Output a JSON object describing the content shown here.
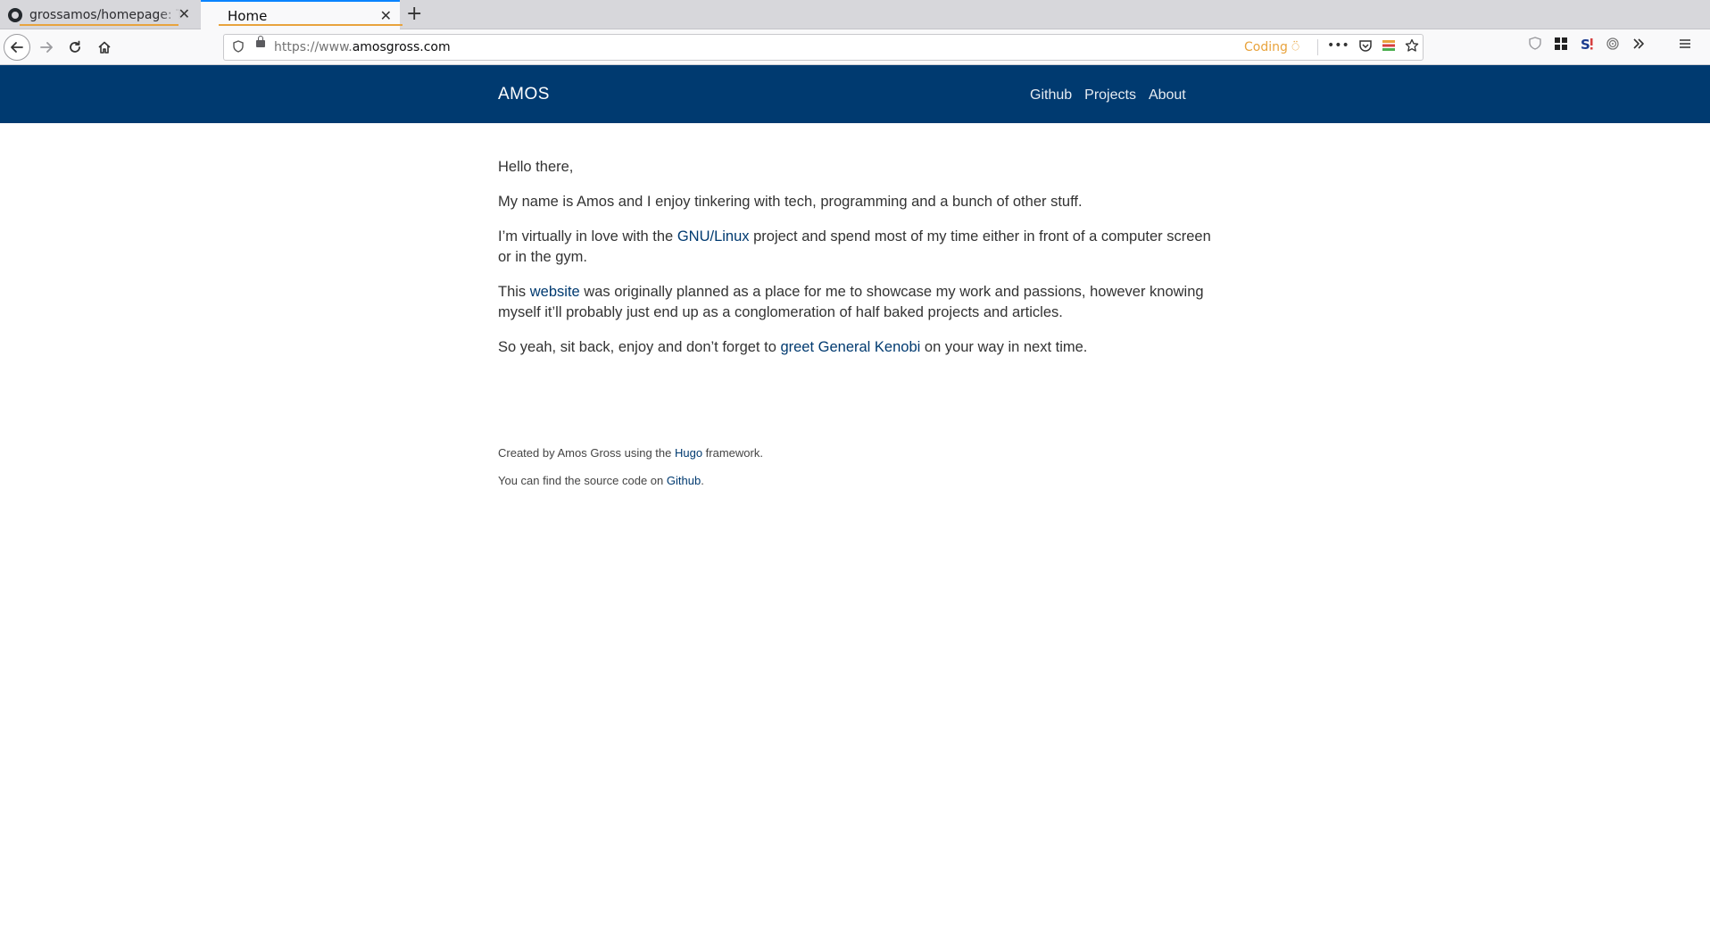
{
  "browser": {
    "tabs": [
      {
        "label": "grossamos/homepage: T"
      },
      {
        "label": "Home"
      }
    ],
    "close_glyph": "✕",
    "new_tab_glyph": "+",
    "url_protocol": "https://www.",
    "url_domain": "amosgross.com",
    "coding_badge": "Coding",
    "coding_icon": "⍥"
  },
  "site": {
    "brand": "AMOS",
    "menu": [
      "Github",
      "Projects",
      "About"
    ]
  },
  "content": {
    "p1": "Hello there,",
    "p2": "My name is Amos and I enjoy tinkering with tech, programming and a bunch of other stuff.",
    "p3_before": "I’m virtually in love with the ",
    "p3_link": "GNU/Linux",
    "p3_after": " project and spend most of my time either in front of a computer screen or in the gym.",
    "p4_before": "This ",
    "p4_link": "website",
    "p4_after": " was originally planned as a place for me to showcase my work and passions, however knowing myself it’ll probably just end up as a conglomeration of half baked projects and articles.",
    "p5_before": "So yeah, sit back, enjoy and don’t forget to ",
    "p5_link": "greet General Kenobi",
    "p5_after": " on your way in next time."
  },
  "footer": {
    "line1_before": "Created by Amos Gross using the ",
    "line1_link": "Hugo",
    "line1_after": " framework.",
    "line2_before": "You can find the source code on ",
    "line2_link": "Github",
    "line2_after": "."
  },
  "colors": {
    "header_bg": "#003a70",
    "link": "#003a70",
    "tab_accent": "#0a84ff",
    "coding": "#e8a33d"
  }
}
